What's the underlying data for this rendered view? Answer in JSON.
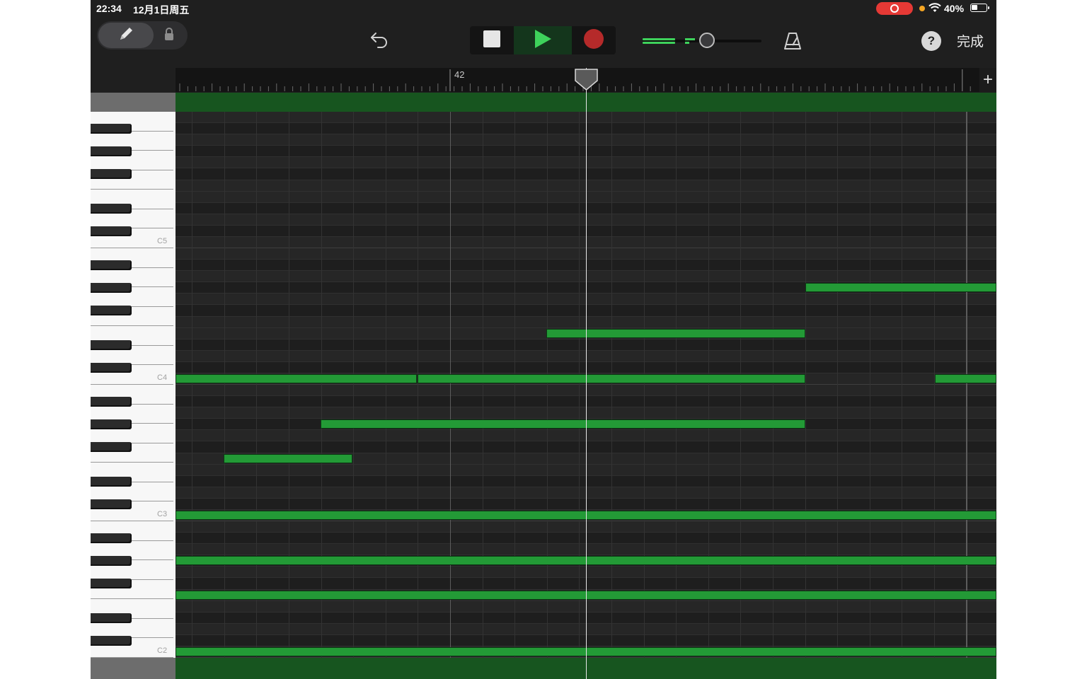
{
  "status_bar": {
    "time": "22:34",
    "date": "12月1日周五",
    "battery": "40%",
    "recording_color": "#e53935",
    "indicator_color": "#f5a623"
  },
  "toolbar": {
    "pencil_icon": "pencil-icon",
    "lock_icon": "lock-icon",
    "undo_icon": "undo-icon",
    "stop_icon": "stop-icon",
    "play_icon": "play-icon",
    "record_icon": "record-icon",
    "metronome_icon": "metronome-icon",
    "help_label": "?",
    "done_label": "完成",
    "play_color": "#3ed25b",
    "record_color": "#b52a2a"
  },
  "ruler": {
    "bar_number": "42",
    "add_label": "+"
  },
  "keyboard": {
    "labels": [
      "C5",
      "C4",
      "C3",
      "C2"
    ]
  },
  "notes": [
    {
      "pitch": "G#4"
    },
    {
      "pitch": "E4"
    },
    {
      "pitch": "C4"
    },
    {
      "pitch": "C4"
    },
    {
      "pitch": "C4"
    },
    {
      "pitch": "G#3"
    },
    {
      "pitch": "F3"
    },
    {
      "pitch": "C3"
    },
    {
      "pitch": "G#2"
    },
    {
      "pitch": "F2"
    },
    {
      "pitch": "C2"
    }
  ],
  "colors": {
    "note": "#239a36",
    "region": "#17551f",
    "background": "#1f1f1f"
  }
}
